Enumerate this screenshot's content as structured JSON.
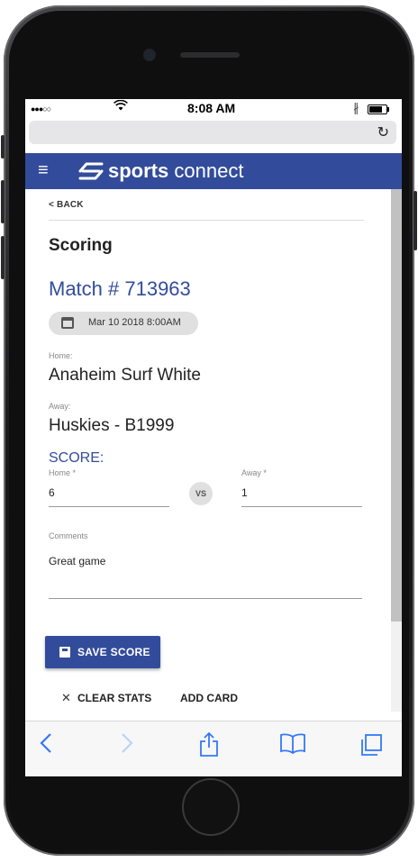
{
  "status_bar": {
    "signal": "●●●○○",
    "time": "8:08 AM"
  },
  "browser": {
    "url": ""
  },
  "app": {
    "logo_bold": "sports",
    "logo_light": "connect",
    "brand_color": "#324c9b"
  },
  "page": {
    "back_label": "< BACK",
    "title": "Scoring",
    "match_label": "Match # 713963",
    "date": "Mar 10 2018 8:00AM"
  },
  "teams": {
    "home_label": "Home:",
    "home_value": "Anaheim Surf White",
    "away_label": "Away:",
    "away_value": "Huskies - B1999"
  },
  "score": {
    "heading": "SCORE:",
    "home_label": "Home *",
    "home_value": "6",
    "vs": "VS",
    "away_label": "Away *",
    "away_value": "1"
  },
  "comments": {
    "label": "Comments",
    "value": "Great game"
  },
  "actions": {
    "save": "SAVE SCORE",
    "clear": "CLEAR STATS",
    "add_card": "ADD CARD"
  },
  "toolbar": {
    "back_icon": "chevron-left-icon",
    "forward_icon": "chevron-right-icon",
    "share_icon": "share-icon",
    "bookmarks_icon": "book-icon",
    "tabs_icon": "tabs-icon"
  }
}
